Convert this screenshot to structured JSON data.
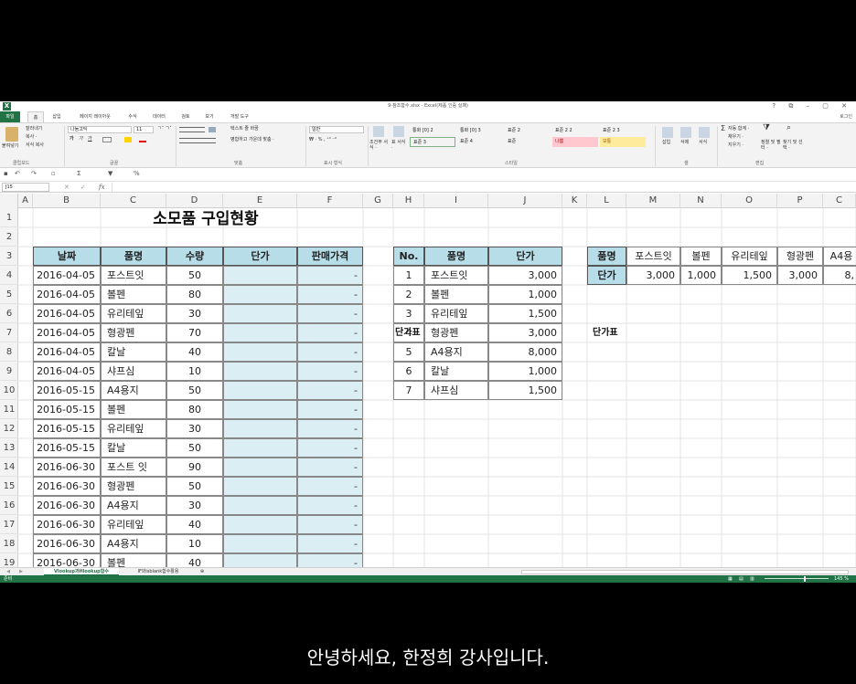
{
  "window": {
    "title": "9-참조함수.xlsx - Excel(제품 인증 실패)",
    "controls": "?  ⧉  –  ▢  ✕",
    "login": "로그인"
  },
  "tabs": [
    "파일",
    "홈",
    "삽입",
    "페이지 레이아웃",
    "수식",
    "데이터",
    "검토",
    "보기",
    "개발 도구"
  ],
  "ribbon": {
    "clipboard": {
      "paste": "붙여넣기",
      "cut": "잘라내기",
      "copy": "복사 ·",
      "format_painter": "서식 복사",
      "label": "클립보드"
    },
    "font": {
      "font_name": "나눔고딕",
      "font_size": "11",
      "bold": "가",
      "italic": "가",
      "underline": "가",
      "label": "글꼴"
    },
    "alignment": {
      "wrap": "텍스트 줄 바꿈",
      "merge": "병합하고 가운데 맞춤 ·",
      "label": "맞춤"
    },
    "number": {
      "format": "일반",
      "label": "표시 형식"
    },
    "styles": {
      "conditional": "조건부 서식 ·",
      "table": "표 서식 ·",
      "cells": [
        "통화 [0] 2",
        "통화 [0] 3",
        "표준 2",
        "표준 2 2",
        "표준 2 3",
        "표준 3",
        "표준 4",
        "표준",
        "나쁨",
        "보통"
      ],
      "label": "스타일"
    },
    "cells": {
      "insert": "삽입",
      "delete": "삭제",
      "format": "서식",
      "label": "셀"
    },
    "editing": {
      "autosum": "자동 합계 ·",
      "fill": "채우기 ·",
      "clear": "지우기 ·",
      "sort": "정렬 및 필터 ·",
      "find": "찾기 및 선택 ·",
      "label": "편집"
    }
  },
  "formula_bar": {
    "name_box": "J15",
    "formula": ""
  },
  "columns": [
    "A",
    "B",
    "C",
    "D",
    "E",
    "F",
    "G",
    "H",
    "I",
    "J",
    "K",
    "L",
    "M",
    "N",
    "O",
    "P",
    "C"
  ],
  "rows": [
    "1",
    "2",
    "3",
    "4",
    "5",
    "6",
    "7",
    "8",
    "9",
    "10",
    "11",
    "12",
    "13",
    "14",
    "15",
    "16",
    "17",
    "18",
    "19"
  ],
  "sheet": {
    "title": "소모품 구입현황",
    "main_headers": [
      "날짜",
      "품명",
      "수량",
      "단가",
      "판매가격"
    ],
    "main_rows": [
      {
        "date": "2016-04-05",
        "item": "포스트잇",
        "qty": "50",
        "price": "",
        "total": "-"
      },
      {
        "date": "2016-04-05",
        "item": "볼펜",
        "qty": "80",
        "price": "",
        "total": "-"
      },
      {
        "date": "2016-04-05",
        "item": "유리테잎",
        "qty": "30",
        "price": "",
        "total": "-"
      },
      {
        "date": "2016-04-05",
        "item": "형광펜",
        "qty": "70",
        "price": "",
        "total": "-"
      },
      {
        "date": "2016-04-05",
        "item": "칼날",
        "qty": "40",
        "price": "",
        "total": "-"
      },
      {
        "date": "2016-04-05",
        "item": "샤프심",
        "qty": "10",
        "price": "",
        "total": "-"
      },
      {
        "date": "2016-05-15",
        "item": "A4용지",
        "qty": "50",
        "price": "",
        "total": "-"
      },
      {
        "date": "2016-05-15",
        "item": "볼펜",
        "qty": "80",
        "price": "",
        "total": "-"
      },
      {
        "date": "2016-05-15",
        "item": "유리테잎",
        "qty": "30",
        "price": "",
        "total": "-"
      },
      {
        "date": "2016-05-15",
        "item": "칼날",
        "qty": "50",
        "price": "",
        "total": "-"
      },
      {
        "date": "2016-06-30",
        "item": "포스트 잇",
        "qty": "90",
        "price": "",
        "total": "-"
      },
      {
        "date": "2016-06-30",
        "item": "형광펜",
        "qty": "50",
        "price": "",
        "total": "-"
      },
      {
        "date": "2016-06-30",
        "item": "A4용지",
        "qty": "30",
        "price": "",
        "total": "-"
      },
      {
        "date": "2016-06-30",
        "item": "유리테잎",
        "qty": "40",
        "price": "",
        "total": "-"
      },
      {
        "date": "2016-06-30",
        "item": "A4용지",
        "qty": "10",
        "price": "",
        "total": "-"
      },
      {
        "date": "2016-06-30",
        "item": "볼펜",
        "qty": "40",
        "price": "",
        "total": "-"
      }
    ],
    "vlookup_title": "단가표",
    "vlookup_headers": [
      "No.",
      "품명",
      "단가"
    ],
    "vlookup_rows": [
      {
        "no": "1",
        "item": "포스트잇",
        "price": "3,000"
      },
      {
        "no": "2",
        "item": "볼펜",
        "price": "1,000"
      },
      {
        "no": "3",
        "item": "유리테잎",
        "price": "1,500"
      },
      {
        "no": "4",
        "item": "형광펜",
        "price": "3,000"
      },
      {
        "no": "5",
        "item": "A4용지",
        "price": "8,000"
      },
      {
        "no": "6",
        "item": "칼날",
        "price": "1,000"
      },
      {
        "no": "7",
        "item": "샤프심",
        "price": "1,500"
      }
    ],
    "hlookup_title": "단가표",
    "hlookup_row_labels": [
      "품명",
      "단가"
    ],
    "hlookup_items": [
      "포스트잇",
      "볼펜",
      "유리테잎",
      "형광펜",
      "A4용"
    ],
    "hlookup_prices": [
      "3,000",
      "1,000",
      "1,500",
      "3,000",
      "8,"
    ]
  },
  "sheet_tabs": [
    "Vlookup과Hlookup함수",
    "IF와isblank함수활용"
  ],
  "status": {
    "ready": "준비",
    "zoom": "145 %"
  },
  "subtitle": "안녕하세요, 한정희 강사입니다.",
  "colors": {
    "excel_green": "#217346",
    "header_fill": "#b7dee8",
    "blank_fill": "#dbeef4"
  }
}
